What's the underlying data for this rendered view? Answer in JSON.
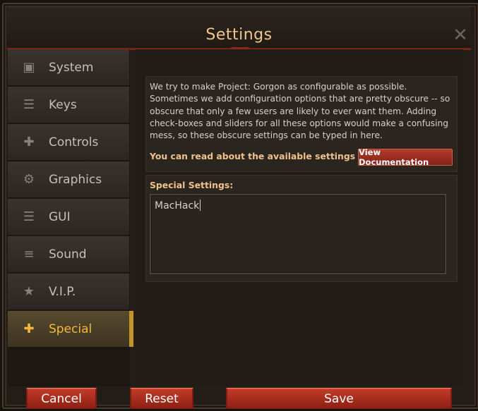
{
  "window": {
    "title": "Settings",
    "close_glyph": "✕"
  },
  "sidebar": {
    "items": [
      {
        "label": "System",
        "icon": "floppy-disk-icon",
        "glyph": "▣"
      },
      {
        "label": "Keys",
        "icon": "list-icon",
        "glyph": "☰"
      },
      {
        "label": "Controls",
        "icon": "puzzle-icon",
        "glyph": "✚"
      },
      {
        "label": "Graphics",
        "icon": "gear-icon",
        "glyph": "⚙"
      },
      {
        "label": "GUI",
        "icon": "list-icon",
        "glyph": "☰"
      },
      {
        "label": "Sound",
        "icon": "sliders-icon",
        "glyph": "≡"
      },
      {
        "label": "V.I.P.",
        "icon": "star-icon",
        "glyph": "★"
      },
      {
        "label": "Special",
        "icon": "puzzle-icon",
        "glyph": "✚",
        "active": true
      }
    ]
  },
  "content": {
    "description": "We try to make Project: Gorgon as configurable as possible. Sometimes we add configuration options that are pretty obscure -- so obscure that only a few users are likely to ever want them. Adding check-boxes and sliders for all these options would make a confusing mess, so these obscure settings can be typed in here.",
    "doc_label": "You can read about the available settings here:",
    "doc_button": "View Documentation",
    "special_label": "Special Settings:",
    "special_value": "MacHack"
  },
  "footer": {
    "cancel": "Cancel",
    "reset": "Reset",
    "save": "Save"
  },
  "colors": {
    "accent": "#f7b73d",
    "button_red": "#b53a2a",
    "title": "#f2c58b"
  }
}
